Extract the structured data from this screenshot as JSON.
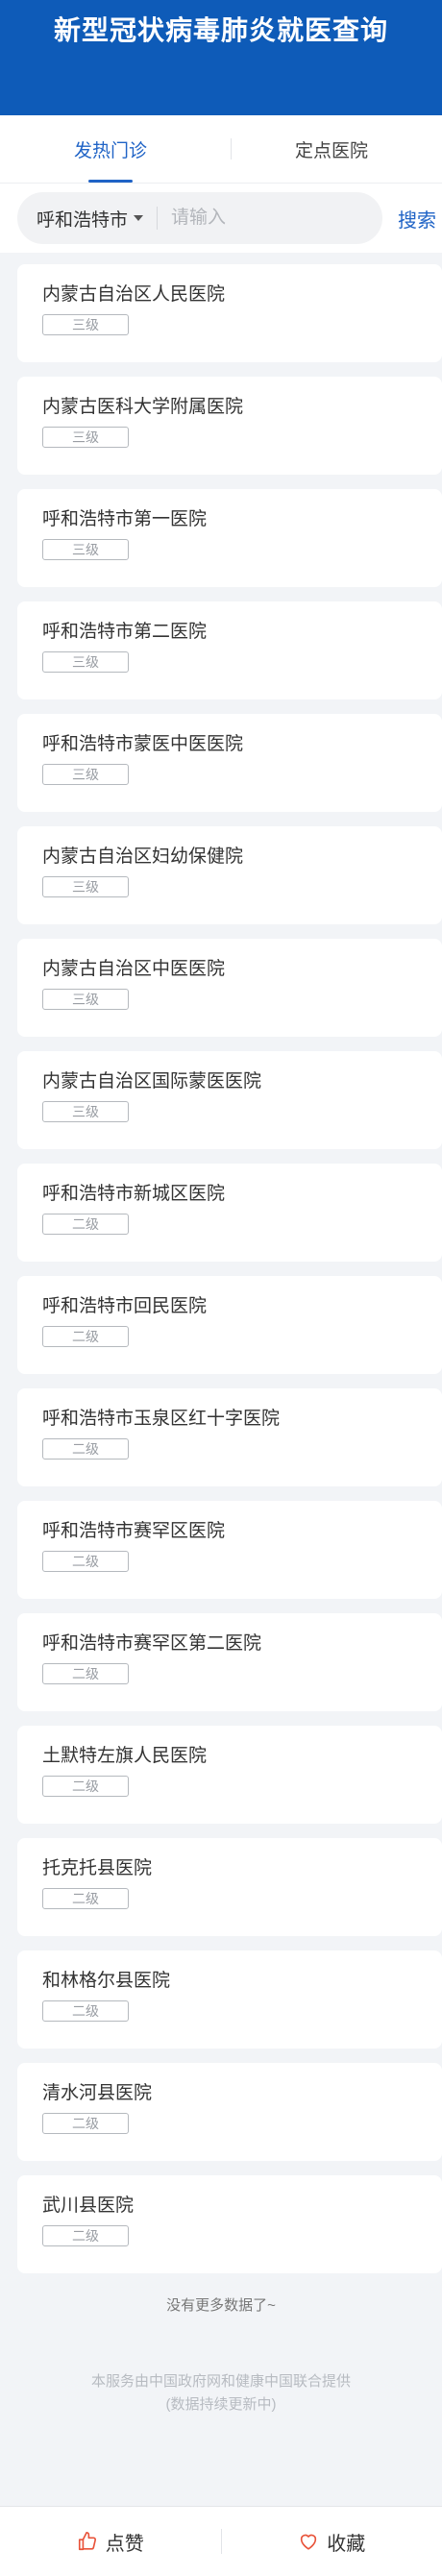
{
  "header": {
    "title": "新型冠状病毒肺炎就医查询"
  },
  "tabs": [
    {
      "label": "发热门诊"
    },
    {
      "label": "定点医院"
    }
  ],
  "search": {
    "city": "呼和浩特市",
    "placeholder": "请输入",
    "button_label": "搜索"
  },
  "hospitals": [
    {
      "name": "内蒙古自治区人民医院",
      "level": "三级"
    },
    {
      "name": "内蒙古医科大学附属医院",
      "level": "三级"
    },
    {
      "name": "呼和浩特市第一医院",
      "level": "三级"
    },
    {
      "name": "呼和浩特市第二医院",
      "level": "三级"
    },
    {
      "name": "呼和浩特市蒙医中医医院",
      "level": "三级"
    },
    {
      "name": "内蒙古自治区妇幼保健院",
      "level": "三级"
    },
    {
      "name": "内蒙古自治区中医医院",
      "level": "三级"
    },
    {
      "name": "内蒙古自治区国际蒙医医院",
      "level": "三级"
    },
    {
      "name": "呼和浩特市新城区医院",
      "level": "二级"
    },
    {
      "name": "呼和浩特市回民医院",
      "level": "二级"
    },
    {
      "name": "呼和浩特市玉泉区红十字医院",
      "level": "二级"
    },
    {
      "name": "呼和浩特市赛罕区医院",
      "level": "二级"
    },
    {
      "name": "呼和浩特市赛罕区第二医院",
      "level": "二级"
    },
    {
      "name": "土默特左旗人民医院",
      "level": "二级"
    },
    {
      "name": "托克托县医院",
      "level": "二级"
    },
    {
      "name": "和林格尔县医院",
      "level": "二级"
    },
    {
      "name": "清水河县医院",
      "level": "二级"
    },
    {
      "name": "武川县医院",
      "level": "二级"
    }
  ],
  "list_end_text": "没有更多数据了~",
  "footer": {
    "line1": "本服务由中国政府网和健康中国联合提供",
    "line2": "(数据持续更新中)"
  },
  "bottom_bar": {
    "like_label": "点赞",
    "like_icon": "thumbs-up-icon",
    "favorite_label": "收藏",
    "favorite_icon": "heart-icon",
    "accent_color": "#e8533a"
  },
  "colors": {
    "brand": "#0e5bb8",
    "accent": "#1f63c6"
  }
}
